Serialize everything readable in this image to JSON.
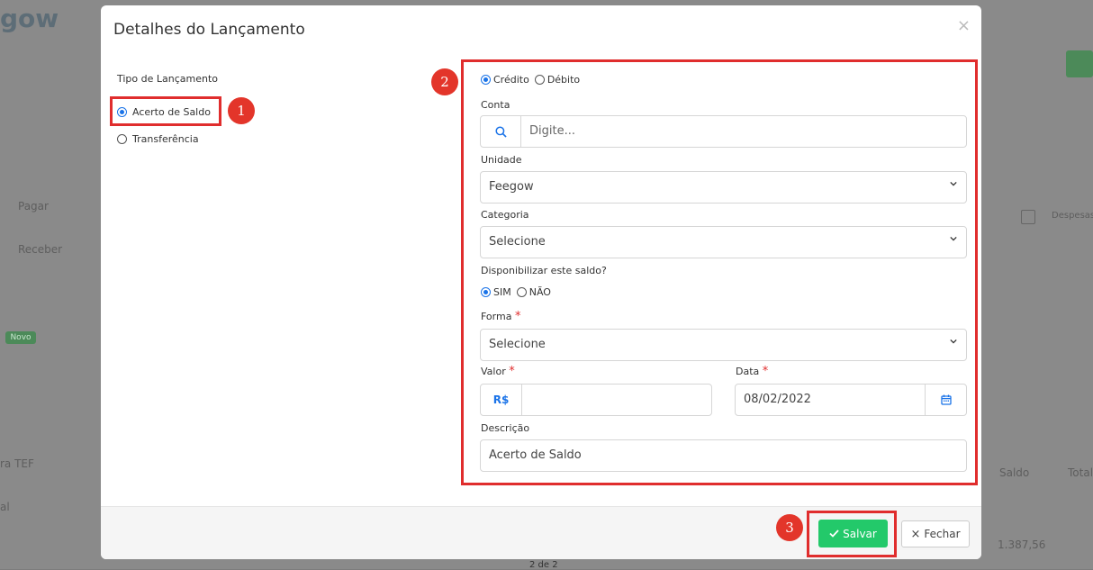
{
  "background": {
    "logo": "gow",
    "side_items": [
      "Pagar",
      "Receber",
      "Novo",
      "ra TEF",
      "al"
    ],
    "right_items": [
      "Despesas",
      "Saldo",
      "Total",
      "1.387,56"
    ]
  },
  "modal": {
    "title": "Detalhes do Lançamento",
    "close_glyph": "×",
    "tipo_label": "Tipo de Lançamento",
    "tipo_options": [
      {
        "label": "Acerto de Saldo",
        "checked": true
      },
      {
        "label": "Transferência",
        "checked": false
      }
    ],
    "type_radios": [
      {
        "label": "Crédito",
        "checked": true
      },
      {
        "label": "Débito",
        "checked": false
      }
    ],
    "conta": {
      "label": "Conta",
      "placeholder": "Digite..."
    },
    "unidade": {
      "label": "Unidade",
      "value": "Feegow"
    },
    "categoria": {
      "label": "Categoria",
      "value": "Selecione"
    },
    "disponibilizar": {
      "label": "Disponibilizar este saldo?",
      "options": [
        {
          "label": "SIM",
          "checked": true
        },
        {
          "label": "NÃO",
          "checked": false
        }
      ]
    },
    "forma": {
      "label": "Forma",
      "value": "Selecione"
    },
    "valor": {
      "label": "Valor",
      "currency": "R$",
      "value": ""
    },
    "data": {
      "label": "Data",
      "value": "08/02/2022"
    },
    "descricao": {
      "label": "Descrição",
      "value": "Acerto de Saldo"
    },
    "required_mark": "*",
    "buttons": {
      "save": "Salvar",
      "close": "Fechar"
    }
  },
  "badges": [
    "1",
    "2",
    "3"
  ],
  "page_indicator": "2 de 2",
  "colors": {
    "accent": "#1a73e8",
    "save": "#23c96a",
    "annotation": "#e02d2d"
  }
}
